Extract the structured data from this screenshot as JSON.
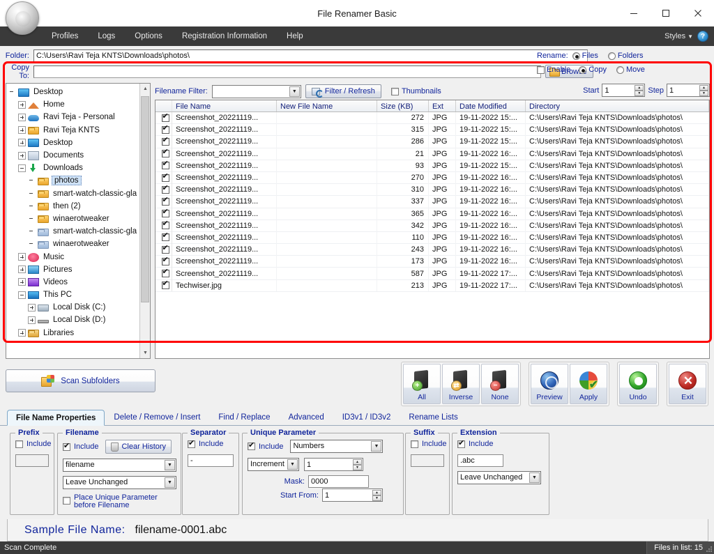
{
  "window": {
    "title": "File Renamer Basic",
    "minimize": "—",
    "maximize": "□",
    "close": "✕"
  },
  "menubar": {
    "items": [
      "Profiles",
      "Logs",
      "Options",
      "Registration Information",
      "Help"
    ],
    "styles_label": "Styles",
    "help_label": "?"
  },
  "paths": {
    "folder_label": "Folder:",
    "folder_value": "C:\\Users\\Ravi Teja KNTS\\Downloads\\photos\\",
    "copyto_label": "Copy To:",
    "copyto_value": "",
    "browse_label": "Browse"
  },
  "rename_options": {
    "rename_label": "Rename:",
    "files_label": "Files",
    "files_selected": true,
    "folders_label": "Folders",
    "folders_selected": false,
    "enable_label": "Enable",
    "enable_checked": false,
    "copy_label": "Copy",
    "copy_selected": true,
    "move_label": "Move",
    "move_selected": false
  },
  "filterbar": {
    "filter_label": "Filename Filter:",
    "filter_value": "",
    "refresh_label": "Filter / Refresh",
    "thumbnails_label": "Thumbnails",
    "thumbnails_checked": false,
    "start_label": "Start",
    "start_value": "1",
    "step_label": "Step",
    "step_value": "1"
  },
  "tree": [
    {
      "label": "Desktop",
      "depth": 0,
      "expander": "none",
      "icon": "desktop-icon",
      "selected": false
    },
    {
      "label": "Home",
      "depth": 1,
      "expander": "plus",
      "icon": "home-icon",
      "selected": false
    },
    {
      "label": "Ravi Teja - Personal",
      "depth": 1,
      "expander": "plus",
      "icon": "cloud-icon",
      "selected": false
    },
    {
      "label": "Ravi Teja KNTS",
      "depth": 1,
      "expander": "plus",
      "icon": "folder-icon",
      "selected": false
    },
    {
      "label": "Desktop",
      "depth": 1,
      "expander": "plus",
      "icon": "desktop-icon",
      "selected": false
    },
    {
      "label": "Documents",
      "depth": 1,
      "expander": "plus",
      "icon": "documents-icon",
      "selected": false
    },
    {
      "label": "Downloads",
      "depth": 1,
      "expander": "minus",
      "icon": "downloads-icon",
      "selected": false
    },
    {
      "label": "photos",
      "depth": 2,
      "expander": "none",
      "icon": "folder-icon",
      "selected": true
    },
    {
      "label": "smart-watch-classic-gla",
      "depth": 2,
      "expander": "none",
      "icon": "folder-icon",
      "selected": false
    },
    {
      "label": "then (2)",
      "depth": 2,
      "expander": "none",
      "icon": "folder-icon",
      "selected": false
    },
    {
      "label": "winaerotweaker",
      "depth": 2,
      "expander": "none",
      "icon": "folder-icon",
      "selected": false
    },
    {
      "label": "smart-watch-classic-gla",
      "depth": 2,
      "expander": "none",
      "icon": "folder-open-icon",
      "selected": false
    },
    {
      "label": "winaerotweaker",
      "depth": 2,
      "expander": "none",
      "icon": "folder-open-icon",
      "selected": false
    },
    {
      "label": "Music",
      "depth": 1,
      "expander": "plus",
      "icon": "music-icon",
      "selected": false
    },
    {
      "label": "Pictures",
      "depth": 1,
      "expander": "plus",
      "icon": "pictures-icon",
      "selected": false
    },
    {
      "label": "Videos",
      "depth": 1,
      "expander": "plus",
      "icon": "videos-icon",
      "selected": false
    },
    {
      "label": "This PC",
      "depth": 1,
      "expander": "minus",
      "icon": "pc-icon",
      "selected": false
    },
    {
      "label": "Local Disk (C:)",
      "depth": 2,
      "expander": "plus",
      "icon": "disk-c-icon",
      "selected": false
    },
    {
      "label": "Local Disk (D:)",
      "depth": 2,
      "expander": "plus",
      "icon": "disk-d-icon",
      "selected": false
    },
    {
      "label": "Libraries",
      "depth": 1,
      "expander": "plus",
      "icon": "libraries-icon",
      "selected": false
    }
  ],
  "filelist": {
    "columns": [
      "File Name",
      "New File Name",
      "Size (KB)",
      "Ext",
      "Date Modified",
      "Directory"
    ],
    "rows": [
      {
        "checked": true,
        "name": "Screenshot_20221119...",
        "new_name": "",
        "size": "272",
        "ext": "JPG",
        "date": "19-11-2022 15:...",
        "dir": "C:\\Users\\Ravi Teja KNTS\\Downloads\\photos\\"
      },
      {
        "checked": true,
        "name": "Screenshot_20221119...",
        "new_name": "",
        "size": "315",
        "ext": "JPG",
        "date": "19-11-2022 15:...",
        "dir": "C:\\Users\\Ravi Teja KNTS\\Downloads\\photos\\"
      },
      {
        "checked": true,
        "name": "Screenshot_20221119...",
        "new_name": "",
        "size": "286",
        "ext": "JPG",
        "date": "19-11-2022 15:...",
        "dir": "C:\\Users\\Ravi Teja KNTS\\Downloads\\photos\\"
      },
      {
        "checked": true,
        "name": "Screenshot_20221119...",
        "new_name": "",
        "size": "21",
        "ext": "JPG",
        "date": "19-11-2022 16:...",
        "dir": "C:\\Users\\Ravi Teja KNTS\\Downloads\\photos\\"
      },
      {
        "checked": true,
        "name": "Screenshot_20221119...",
        "new_name": "",
        "size": "93",
        "ext": "JPG",
        "date": "19-11-2022 15:...",
        "dir": "C:\\Users\\Ravi Teja KNTS\\Downloads\\photos\\"
      },
      {
        "checked": true,
        "name": "Screenshot_20221119...",
        "new_name": "",
        "size": "270",
        "ext": "JPG",
        "date": "19-11-2022 16:...",
        "dir": "C:\\Users\\Ravi Teja KNTS\\Downloads\\photos\\"
      },
      {
        "checked": true,
        "name": "Screenshot_20221119...",
        "new_name": "",
        "size": "310",
        "ext": "JPG",
        "date": "19-11-2022 16:...",
        "dir": "C:\\Users\\Ravi Teja KNTS\\Downloads\\photos\\"
      },
      {
        "checked": true,
        "name": "Screenshot_20221119...",
        "new_name": "",
        "size": "337",
        "ext": "JPG",
        "date": "19-11-2022 16:...",
        "dir": "C:\\Users\\Ravi Teja KNTS\\Downloads\\photos\\"
      },
      {
        "checked": true,
        "name": "Screenshot_20221119...",
        "new_name": "",
        "size": "365",
        "ext": "JPG",
        "date": "19-11-2022 16:...",
        "dir": "C:\\Users\\Ravi Teja KNTS\\Downloads\\photos\\"
      },
      {
        "checked": true,
        "name": "Screenshot_20221119...",
        "new_name": "",
        "size": "342",
        "ext": "JPG",
        "date": "19-11-2022 16:...",
        "dir": "C:\\Users\\Ravi Teja KNTS\\Downloads\\photos\\"
      },
      {
        "checked": true,
        "name": "Screenshot_20221119...",
        "new_name": "",
        "size": "110",
        "ext": "JPG",
        "date": "19-11-2022 16:...",
        "dir": "C:\\Users\\Ravi Teja KNTS\\Downloads\\photos\\"
      },
      {
        "checked": true,
        "name": "Screenshot_20221119...",
        "new_name": "",
        "size": "243",
        "ext": "JPG",
        "date": "19-11-2022 16:...",
        "dir": "C:\\Users\\Ravi Teja KNTS\\Downloads\\photos\\"
      },
      {
        "checked": true,
        "name": "Screenshot_20221119...",
        "new_name": "",
        "size": "173",
        "ext": "JPG",
        "date": "19-11-2022 16:...",
        "dir": "C:\\Users\\Ravi Teja KNTS\\Downloads\\photos\\"
      },
      {
        "checked": true,
        "name": "Screenshot_20221119...",
        "new_name": "",
        "size": "587",
        "ext": "JPG",
        "date": "19-11-2022 17:...",
        "dir": "C:\\Users\\Ravi Teja KNTS\\Downloads\\photos\\"
      },
      {
        "checked": true,
        "name": "Techwiser.jpg",
        "new_name": "",
        "size": "213",
        "ext": "JPG",
        "date": "19-11-2022 17:...",
        "dir": "C:\\Users\\Ravi Teja KNTS\\Downloads\\photos\\"
      }
    ]
  },
  "actions": {
    "scan_subfolders": "Scan Subfolders",
    "buttons": [
      {
        "label": "All",
        "icon": "select-all-icon"
      },
      {
        "label": "Inverse",
        "icon": "select-inverse-icon"
      },
      {
        "label": "None",
        "icon": "select-none-icon"
      },
      {
        "label": "Preview",
        "icon": "preview-globe-icon"
      },
      {
        "label": "Apply",
        "icon": "apply-icon"
      },
      {
        "label": "Undo",
        "icon": "undo-icon"
      },
      {
        "label": "Exit",
        "icon": "exit-icon"
      }
    ]
  },
  "tabs": [
    {
      "label": "File Name Properties",
      "active": true
    },
    {
      "label": "Delete / Remove / Insert",
      "active": false
    },
    {
      "label": "Find / Replace",
      "active": false
    },
    {
      "label": "Advanced",
      "active": false
    },
    {
      "label": "ID3v1 / ID3v2",
      "active": false
    },
    {
      "label": "Rename Lists",
      "active": false
    }
  ],
  "properties": {
    "prefix": {
      "title": "Prefix",
      "include_label": "Include",
      "include_checked": false,
      "value": ""
    },
    "filename": {
      "title": "Filename",
      "include_label": "Include",
      "include_checked": true,
      "clear_history_label": "Clear History",
      "source_value": "filename",
      "case_value": "Leave Unchanged",
      "place_unique_label_line1": "Place Unique Parameter",
      "place_unique_label_line2": "before Filename",
      "place_unique_checked": false
    },
    "separator": {
      "title": "Separator",
      "include_label": "Include",
      "include_checked": true,
      "value": "-"
    },
    "unique_parameter": {
      "title": "Unique Parameter",
      "include_label": "Include",
      "include_checked": true,
      "type_value": "Numbers",
      "mode_value": "Increment",
      "increment_value": "1",
      "mask_label": "Mask:",
      "mask_value": "0000",
      "start_from_label": "Start From:",
      "start_from_value": "1"
    },
    "suffix": {
      "title": "Suffix",
      "include_label": "Include",
      "include_checked": false,
      "value": ""
    },
    "extension": {
      "title": "Extension",
      "include_label": "Include",
      "include_checked": true,
      "value": ".abc",
      "case_value": "Leave Unchanged"
    }
  },
  "sample": {
    "label": "Sample File Name:",
    "value": "filename-0001.abc"
  },
  "status": {
    "message": "Scan Complete",
    "files_in_list": "Files in list: 15"
  }
}
